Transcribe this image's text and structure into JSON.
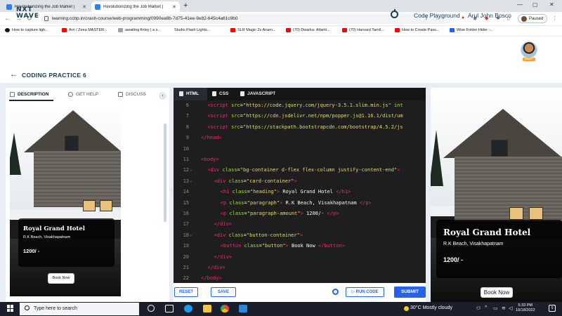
{
  "browser": {
    "tabs": [
      {
        "title": "Revolutionizing the Job Market |",
        "active": false
      },
      {
        "title": "Revolutionizing the Job Market |",
        "active": true
      }
    ],
    "new_tab": "+",
    "url": "learning.ccbp.in/crash-course/web-programming/0990ea8b-7d75-41ee-9e82-645c4a61c9b0",
    "profile_status": "Paused",
    "bookmarks": [
      "How to capture ligh...",
      "Arn / Zeea MASTER...",
      "awaiting finley | a s...",
      "Studio Flash Lights...",
      "SLR Magic 2x Anam...",
      "(70) Dwarka: Atlanti...",
      "(70) Harvard Tamil...",
      "How to Create Pass...",
      "Wise Folder Hider -..."
    ]
  },
  "header": {
    "logo_top": "NXT",
    "logo_bottom": "WAVE",
    "playground": "Code Playground",
    "user_name": "Arul John Bosco",
    "avatar_badge": "SMART"
  },
  "page": {
    "title": "CODING PRACTICE 6"
  },
  "left_tabs": [
    {
      "label": "DESCRIPTION",
      "active": true
    },
    {
      "label": "GET HELP",
      "active": false
    },
    {
      "label": "DISCUSS",
      "active": false
    }
  ],
  "collapse_label": "‹",
  "preview": {
    "heading": "Royal Grand Hotel",
    "paragraph": "R.K Beach, Visakhapatnam",
    "amount": "1200/ -",
    "button": "Book Now"
  },
  "editor": {
    "tabs": [
      {
        "label": "HTML",
        "active": true
      },
      {
        "label": "CSS",
        "active": false
      },
      {
        "label": "JAVASCRIPT",
        "active": false
      }
    ],
    "lines": [
      {
        "n": "6",
        "fold": "",
        "indent": 2,
        "html": "<span class='t'>&lt;script</span> <span class='a'>src</span><span class='p'>=</span><span class='s'>\"https://code.jquery.com/jquery-3.5.1.slim.min.js\"</span> <span class='a'>int</span>"
      },
      {
        "n": "7",
        "fold": "",
        "indent": 2,
        "html": "<span class='t'>&lt;script</span> <span class='a'>src</span><span class='p'>=</span><span class='s'>\"https://cdn.jsdelivr.net/npm/popper.js@1.16.1/dist/um</span>"
      },
      {
        "n": "8",
        "fold": "",
        "indent": 2,
        "html": "<span class='t'>&lt;script</span> <span class='a'>src</span><span class='p'>=</span><span class='s'>\"https://stackpath.bootstrapcdn.com/bootstrap/4.5.2/js</span>"
      },
      {
        "n": "9",
        "fold": "",
        "indent": 1,
        "html": "<span class='t'>&lt;/head&gt;</span>"
      },
      {
        "n": "10",
        "fold": "",
        "indent": 0,
        "html": ""
      },
      {
        "n": "11",
        "fold": "",
        "indent": 1,
        "html": "<span class='t'>&lt;body&gt;</span>"
      },
      {
        "n": "12",
        "fold": "⌄",
        "indent": 2,
        "html": "<span class='t'>&lt;div</span> <span class='a'>class</span><span class='p'>=</span><span class='s'>\"bg-container d-flex flex-column justify-content-end\"</span><span class='t'>&gt;</span>"
      },
      {
        "n": "13",
        "fold": "⌄",
        "indent": 3,
        "html": "<span class='t'>&lt;div</span> <span class='a'>class</span><span class='p'>=</span><span class='s'>\"card-container\"</span><span class='t'>&gt;</span>"
      },
      {
        "n": "14",
        "fold": "",
        "indent": 4,
        "html": "<span class='t'>&lt;h1</span> <span class='a'>class</span><span class='p'>=</span><span class='s'>\"heading\"</span><span class='t'>&gt;</span> Royal Grand Hotel <span class='t'>&lt;/h1&gt;</span>"
      },
      {
        "n": "15",
        "fold": "",
        "indent": 4,
        "html": "<span class='t'>&lt;p</span> <span class='a'>class</span><span class='p'>=</span><span class='s'>\"paragraph\"</span><span class='t'>&gt;</span> R.K Beach, Visakhapatnam <span class='t'>&lt;/p&gt;</span>"
      },
      {
        "n": "16",
        "fold": "",
        "indent": 4,
        "html": "<span class='t'>&lt;p</span> <span class='a'>class</span><span class='p'>=</span><span class='s'>\"paragraph-amount\"</span><span class='t'>&gt;</span> 1200/- <span class='t'>&lt;/p&gt;</span>"
      },
      {
        "n": "17",
        "fold": "",
        "indent": 3,
        "html": "<span class='t'>&lt;/div&gt;</span>"
      },
      {
        "n": "18",
        "fold": "⌄",
        "indent": 3,
        "html": "<span class='t'>&lt;div</span> <span class='a'>class</span><span class='p'>=</span><span class='s'>\"button-container\"</span><span class='t'>&gt;</span>"
      },
      {
        "n": "19",
        "fold": "",
        "indent": 4,
        "html": "<span class='t'>&lt;button</span> <span class='a'>class</span><span class='p'>=</span><span class='s'>\"button\"</span><span class='t'>&gt;</span> Book Now <span class='t'>&lt;/button&gt;</span>"
      },
      {
        "n": "20",
        "fold": "",
        "indent": 3,
        "html": "<span class='t'>&lt;/div&gt;</span>"
      },
      {
        "n": "21",
        "fold": "",
        "indent": 2,
        "html": "<span class='t'>&lt;/div&gt;</span>"
      },
      {
        "n": "22",
        "fold": "",
        "indent": 1,
        "html": "<span class='t'>&lt;/body&gt;</span>"
      }
    ],
    "reset": "RESET",
    "save": "SAVE",
    "run": "RUN CODE",
    "submit": "SUBMIT"
  },
  "taskbar": {
    "search_placeholder": "Type here to search",
    "weather": "30°C  Mostly cloudy",
    "time": "5:33 PM",
    "date": "10/18/2022",
    "notifications": "5"
  }
}
